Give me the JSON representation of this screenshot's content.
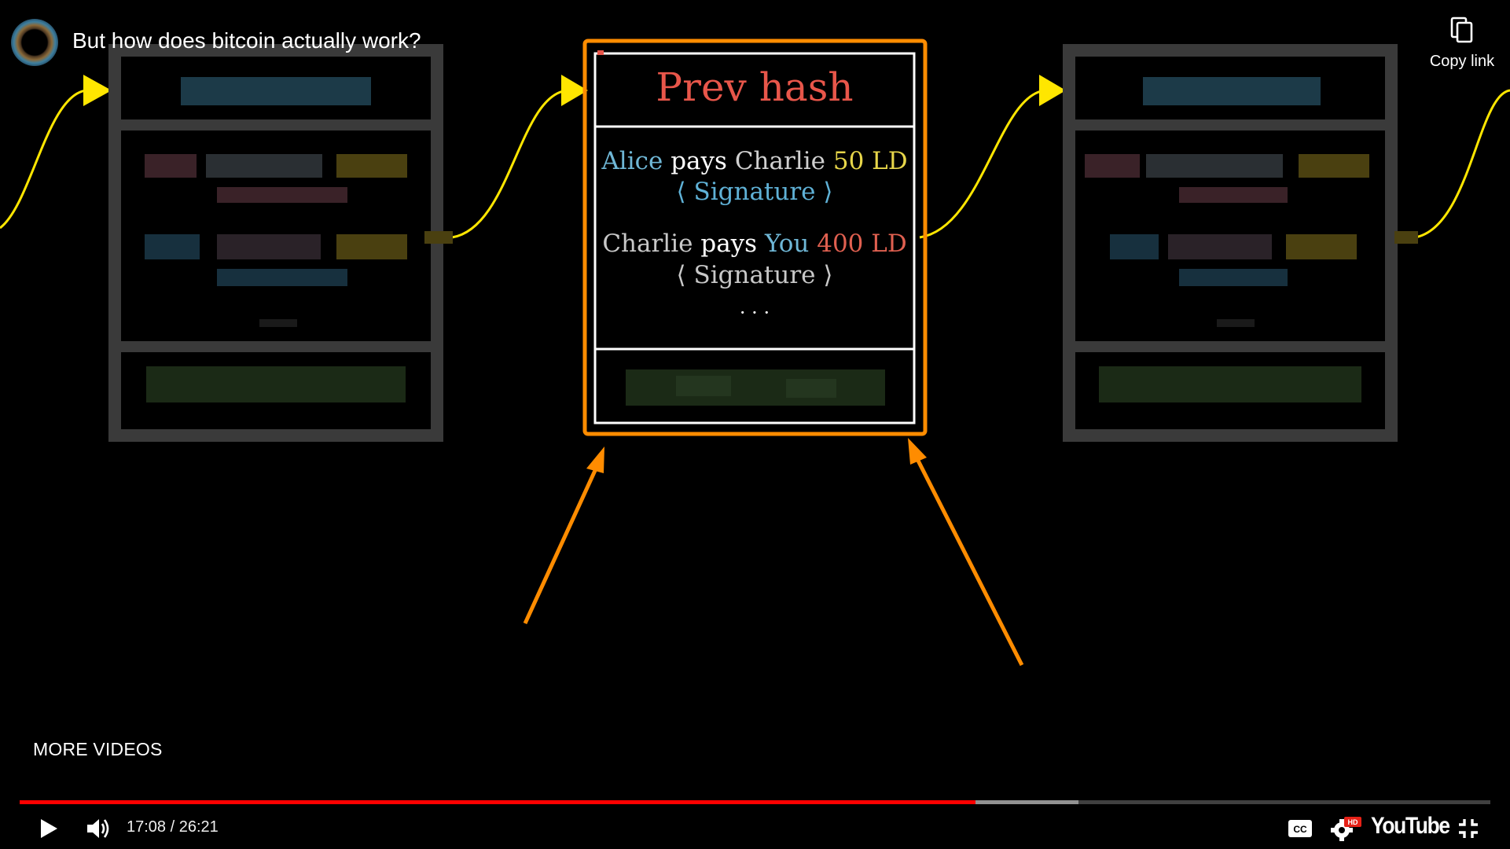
{
  "video": {
    "title": "But how does bitcoin actually work?",
    "current_time": "17:08",
    "duration": "26:21",
    "time_separator": " / ",
    "played_fraction": 0.65,
    "buffered_fraction": 0.72
  },
  "overlay": {
    "copy_link_label": "Copy link",
    "more_videos_label": "MORE VIDEOS"
  },
  "block": {
    "prev_hash": "Prev hash",
    "transactions": [
      {
        "from": "Alice",
        "verb": "pays",
        "to": "Charlie",
        "amount": "50 LD",
        "signature": "⟨ Signature ⟩",
        "colors": {
          "from": "#6fb7d6",
          "verb": "#ffffff",
          "to": "#d0d0d0",
          "amount": "#e7d64a",
          "signature": "#5fb1d6"
        }
      },
      {
        "from": "Charlie",
        "verb": "pays",
        "to": "You",
        "amount": "400 LD",
        "signature": "⟨ Signature ⟩",
        "colors": {
          "from": "#c8c8c8",
          "verb": "#ffffff",
          "to": "#6fb7d6",
          "amount": "#e06050",
          "signature": "#c8c8c8"
        }
      }
    ],
    "ellipsis": "· · ·"
  },
  "branding": {
    "youtube_logo": "YouTube"
  },
  "colors": {
    "highlight": "#ff8c00",
    "arrow": "#ff8c00",
    "chain_link": "#ffe600",
    "progress_played": "#ff0000",
    "prev_hash_text": "#e8564a"
  },
  "icons": {
    "play": "play-icon",
    "volume": "volume-icon",
    "captions": "captions-icon",
    "settings": "settings-icon",
    "exit_fullscreen": "exit-fullscreen-icon",
    "copy": "copy-icon"
  }
}
